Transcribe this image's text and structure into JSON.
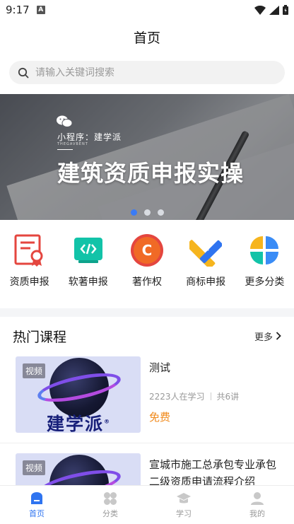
{
  "status_bar": {
    "time": "9:17",
    "notif_letter": "A"
  },
  "header": {
    "title": "首页"
  },
  "search": {
    "placeholder": "请输入关键词搜索"
  },
  "banner": {
    "mini_program": "小程序：建学派",
    "mini_sub": "THEGAVBENT",
    "headline": "建筑资质申报实操",
    "dots": 3,
    "active_dot": 0
  },
  "categories": [
    {
      "label": "资质申报",
      "icon": "certificate-icon"
    },
    {
      "label": "软著申报",
      "icon": "code-icon"
    },
    {
      "label": "著作权",
      "icon": "copyright-icon"
    },
    {
      "label": "商标申报",
      "icon": "ruler-pencil-icon"
    },
    {
      "label": "更多分类",
      "icon": "grid-icon"
    }
  ],
  "hot_courses": {
    "title": "热门课程",
    "more": "更多",
    "courses": [
      {
        "tag": "视频",
        "brand": "建学派",
        "title": "测试",
        "learners": "2223人在学习",
        "lessons": "共6讲",
        "price": "免费"
      },
      {
        "tag": "视频",
        "title": "宣城市施工总承包专业承包二级资质申请流程介绍"
      }
    ]
  },
  "tabbar": [
    {
      "label": "首页",
      "icon": "home-icon",
      "active": true
    },
    {
      "label": "分类",
      "icon": "category-icon",
      "active": false
    },
    {
      "label": "学习",
      "icon": "graduation-cap-icon",
      "active": false
    },
    {
      "label": "我的",
      "icon": "user-icon",
      "active": false
    }
  ],
  "colors": {
    "accent": "#2f74f0",
    "price": "#f08a1c",
    "dot_active": "#3a7bf5"
  }
}
